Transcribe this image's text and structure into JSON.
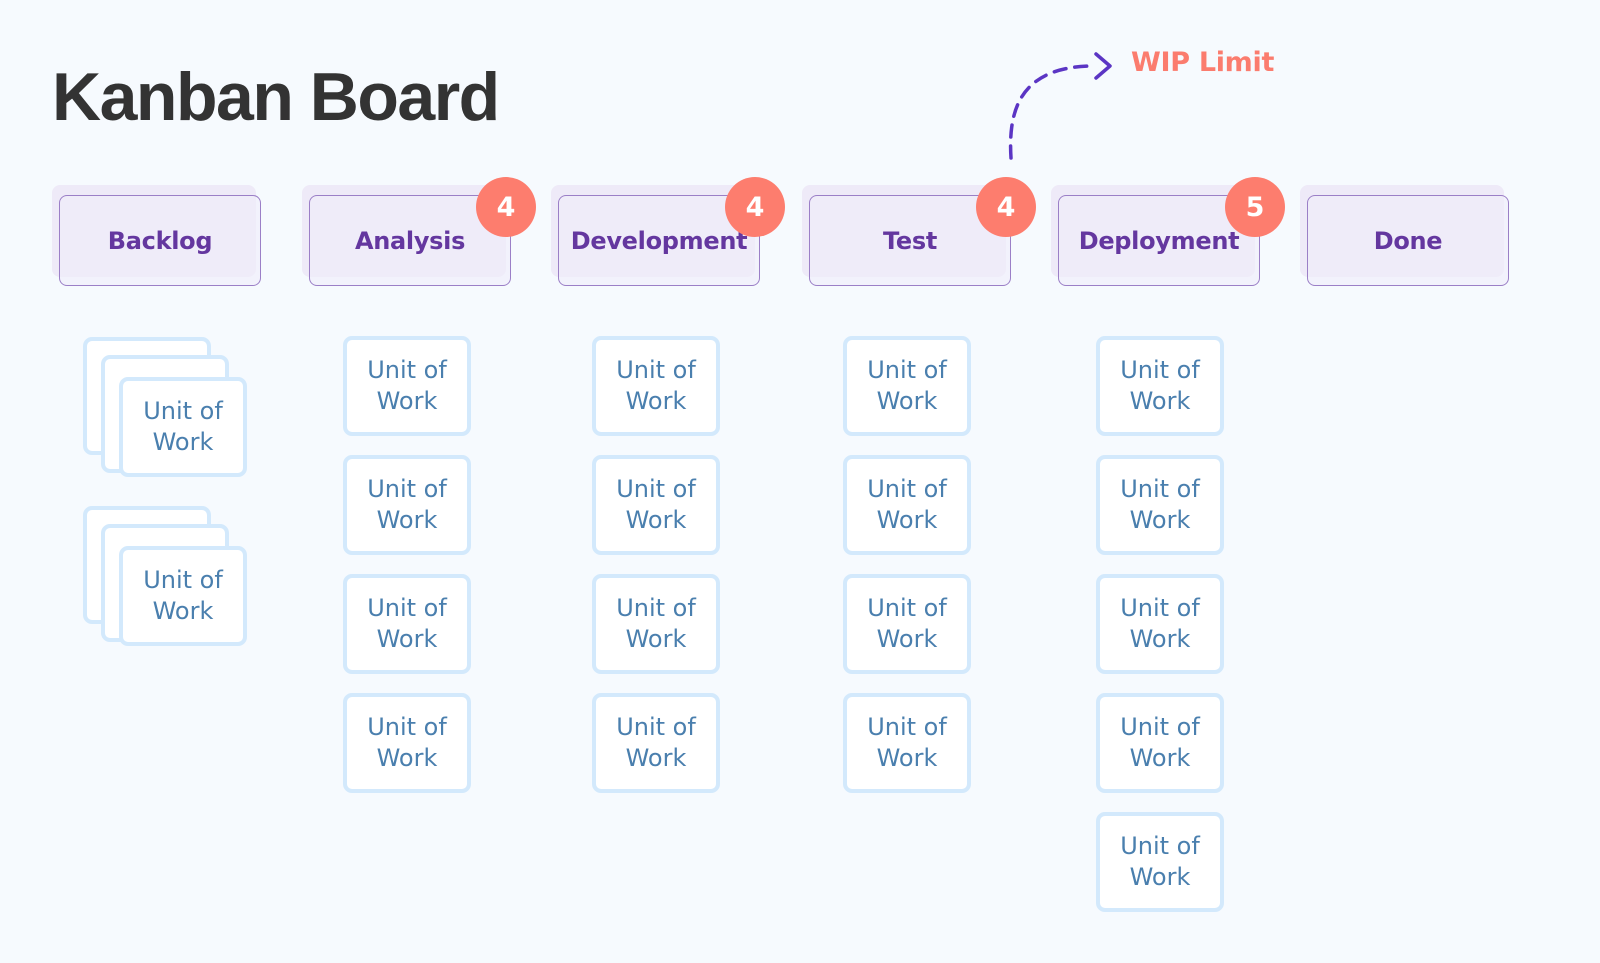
{
  "title": "Kanban Board",
  "wip_annotation": {
    "label": "WIP Limit",
    "arrow_icon": "dashed-curved-arrow-icon",
    "color": "#fb7c6e",
    "arrow_color": "#5b35c4"
  },
  "colors": {
    "background": "#f6fafe",
    "column_header_text": "#64379f",
    "column_header_fill": "#eeeaf8",
    "column_header_border": "#9b7fc7",
    "badge": "#fd7d6e",
    "card_border": "#d3e9fc",
    "card_text": "#4a7fae"
  },
  "columns": [
    {
      "name": "Backlog",
      "wip_limit": null,
      "card_count": 2,
      "stacked": true
    },
    {
      "name": "Analysis",
      "wip_limit": "4",
      "card_count": 4,
      "stacked": false
    },
    {
      "name": "Development",
      "wip_limit": "4",
      "card_count": 4,
      "stacked": false
    },
    {
      "name": "Test",
      "wip_limit": "4",
      "card_count": 4,
      "stacked": false
    },
    {
      "name": "Deployment",
      "wip_limit": "5",
      "card_count": 5,
      "stacked": false
    },
    {
      "name": "Done",
      "wip_limit": null,
      "card_count": 0,
      "stacked": false
    }
  ],
  "card": {
    "line1": "Unit of",
    "line2": "Work"
  }
}
